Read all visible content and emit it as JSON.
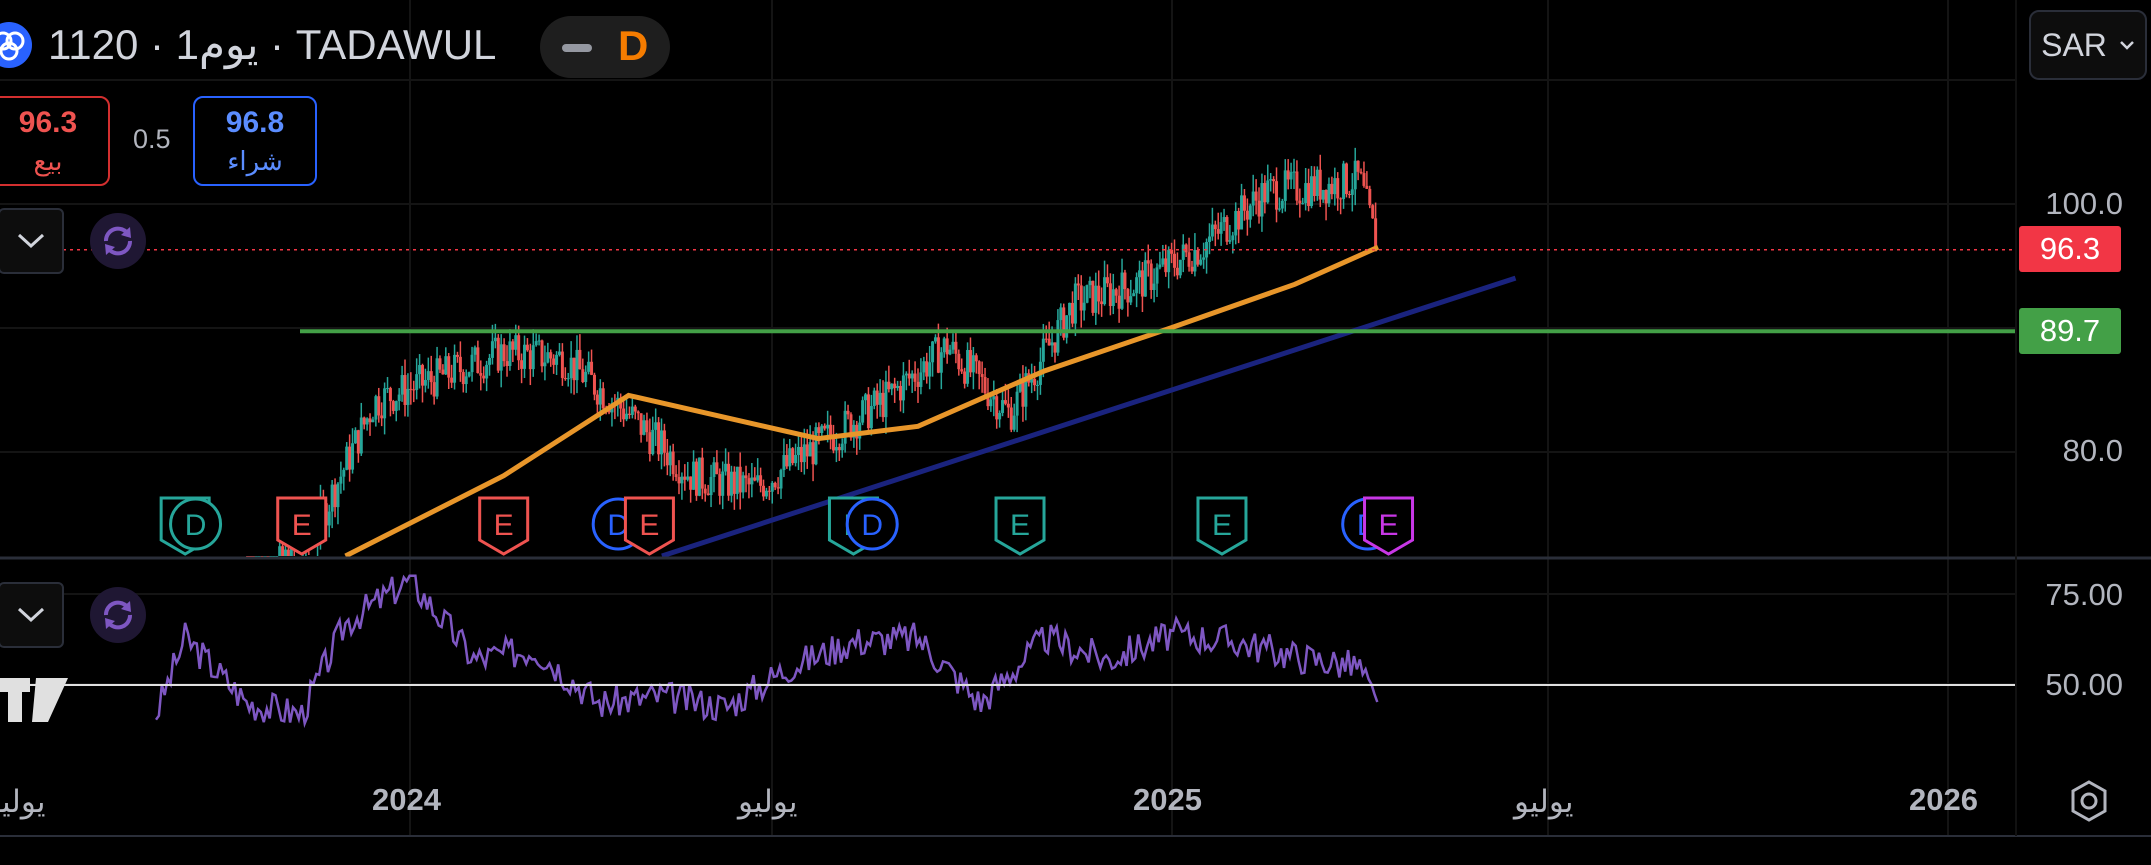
{
  "header": {
    "title": "1120 · يوم1 · TADAWUL",
    "interval_label": "D",
    "currency": "SAR"
  },
  "trade": {
    "sell_price": "96.3",
    "sell_label": "بيع",
    "spread": "0.5",
    "buy_price": "96.8",
    "buy_label": "شراء"
  },
  "price_axis": {
    "ticks": [
      "100.0",
      "80.0"
    ],
    "last_price_tag": "96.3",
    "level_tag": "89.7"
  },
  "indicator_axis": {
    "ticks": [
      "75.00",
      "50.00"
    ]
  },
  "time_axis": {
    "labels": [
      "يوليو",
      "2024",
      "يوليو",
      "2025",
      "يوليو",
      "2026"
    ]
  },
  "colors": {
    "background": "#000000",
    "sell": "#f23645",
    "buy": "#2962ff",
    "up_candle": "#26a69a",
    "down_candle": "#ef5350",
    "ma_line": "#e8962a",
    "trendline": "#1a237e",
    "horizontal_level": "#43a047",
    "rsi_line": "#7e57c2"
  },
  "chart_data": {
    "type": "candlestick",
    "symbol": "1120",
    "exchange": "TADAWUL",
    "interval": "1D",
    "price_range": [
      68,
      110
    ],
    "horizontal_level": 89.7,
    "last_price": 96.3,
    "close_approx": [
      {
        "date": "2023-10-15",
        "close": 68.5
      },
      {
        "date": "2023-11-15",
        "close": 73.0
      },
      {
        "date": "2023-12-15",
        "close": 84.0
      },
      {
        "date": "2024-01-15",
        "close": 86.0
      },
      {
        "date": "2024-02-15",
        "close": 88.0
      },
      {
        "date": "2024-03-15",
        "close": 87.5
      },
      {
        "date": "2024-04-15",
        "close": 83.0
      },
      {
        "date": "2024-05-15",
        "close": 78.0
      },
      {
        "date": "2024-06-15",
        "close": 77.0
      },
      {
        "date": "2024-07-15",
        "close": 80.5
      },
      {
        "date": "2024-08-15",
        "close": 84.0
      },
      {
        "date": "2024-09-15",
        "close": 88.5
      },
      {
        "date": "2024-10-15",
        "close": 83.0
      },
      {
        "date": "2024-11-15",
        "close": 92.0
      },
      {
        "date": "2024-12-15",
        "close": 93.5
      },
      {
        "date": "2025-01-15",
        "close": 96.5
      },
      {
        "date": "2025-02-15",
        "close": 101.0
      },
      {
        "date": "2025-03-15",
        "close": 101.5
      },
      {
        "date": "2025-04-01",
        "close": 102.0
      },
      {
        "date": "2025-04-10",
        "close": 96.3
      }
    ],
    "moving_average_approx": [
      {
        "date": "2023-12-01",
        "value": 66
      },
      {
        "date": "2024-02-15",
        "value": 78
      },
      {
        "date": "2024-04-15",
        "value": 84.5
      },
      {
        "date": "2024-07-15",
        "value": 81
      },
      {
        "date": "2024-09-01",
        "value": 82
      },
      {
        "date": "2024-11-01",
        "value": 86.5
      },
      {
        "date": "2025-01-01",
        "value": 90
      },
      {
        "date": "2025-03-01",
        "value": 93.5
      },
      {
        "date": "2025-04-10",
        "value": 96.5
      }
    ],
    "trendline": [
      {
        "date": "2024-05-01",
        "value": 68
      },
      {
        "date": "2025-06-15",
        "value": 94
      }
    ],
    "events": [
      {
        "date": "2023-09-15",
        "type": "E"
      },
      {
        "date": "2023-09-20",
        "type": "D"
      },
      {
        "date": "2023-11-10",
        "type": "E"
      },
      {
        "date": "2024-02-15",
        "type": "E"
      },
      {
        "date": "2024-04-10",
        "type": "D"
      },
      {
        "date": "2024-04-25",
        "type": "E"
      },
      {
        "date": "2024-08-01",
        "type": "E"
      },
      {
        "date": "2024-08-10",
        "type": "D"
      },
      {
        "date": "2024-10-20",
        "type": "E"
      },
      {
        "date": "2025-01-25",
        "type": "E"
      },
      {
        "date": "2025-04-05",
        "type": "D"
      },
      {
        "date": "2025-04-15",
        "type": "E"
      }
    ],
    "rsi": {
      "range": [
        38,
        80
      ],
      "reference_line": 50,
      "approx": [
        {
          "date": "2023-09-01",
          "value": 42
        },
        {
          "date": "2023-09-15",
          "value": 63
        },
        {
          "date": "2023-10-15",
          "value": 45
        },
        {
          "date": "2023-11-10",
          "value": 42
        },
        {
          "date": "2023-12-01",
          "value": 67
        },
        {
          "date": "2024-01-01",
          "value": 79
        },
        {
          "date": "2024-02-01",
          "value": 57
        },
        {
          "date": "2024-03-01",
          "value": 60
        },
        {
          "date": "2024-04-01",
          "value": 45
        },
        {
          "date": "2024-05-01",
          "value": 47
        },
        {
          "date": "2024-06-01",
          "value": 44
        },
        {
          "date": "2024-07-01",
          "value": 55
        },
        {
          "date": "2024-08-01",
          "value": 62
        },
        {
          "date": "2024-09-01",
          "value": 63
        },
        {
          "date": "2024-10-01",
          "value": 45
        },
        {
          "date": "2024-11-01",
          "value": 63
        },
        {
          "date": "2024-12-01",
          "value": 57
        },
        {
          "date": "2025-01-01",
          "value": 64
        },
        {
          "date": "2025-02-01",
          "value": 62
        },
        {
          "date": "2025-03-01",
          "value": 58
        },
        {
          "date": "2025-04-01",
          "value": 55
        },
        {
          "date": "2025-04-10",
          "value": 43
        }
      ]
    }
  }
}
